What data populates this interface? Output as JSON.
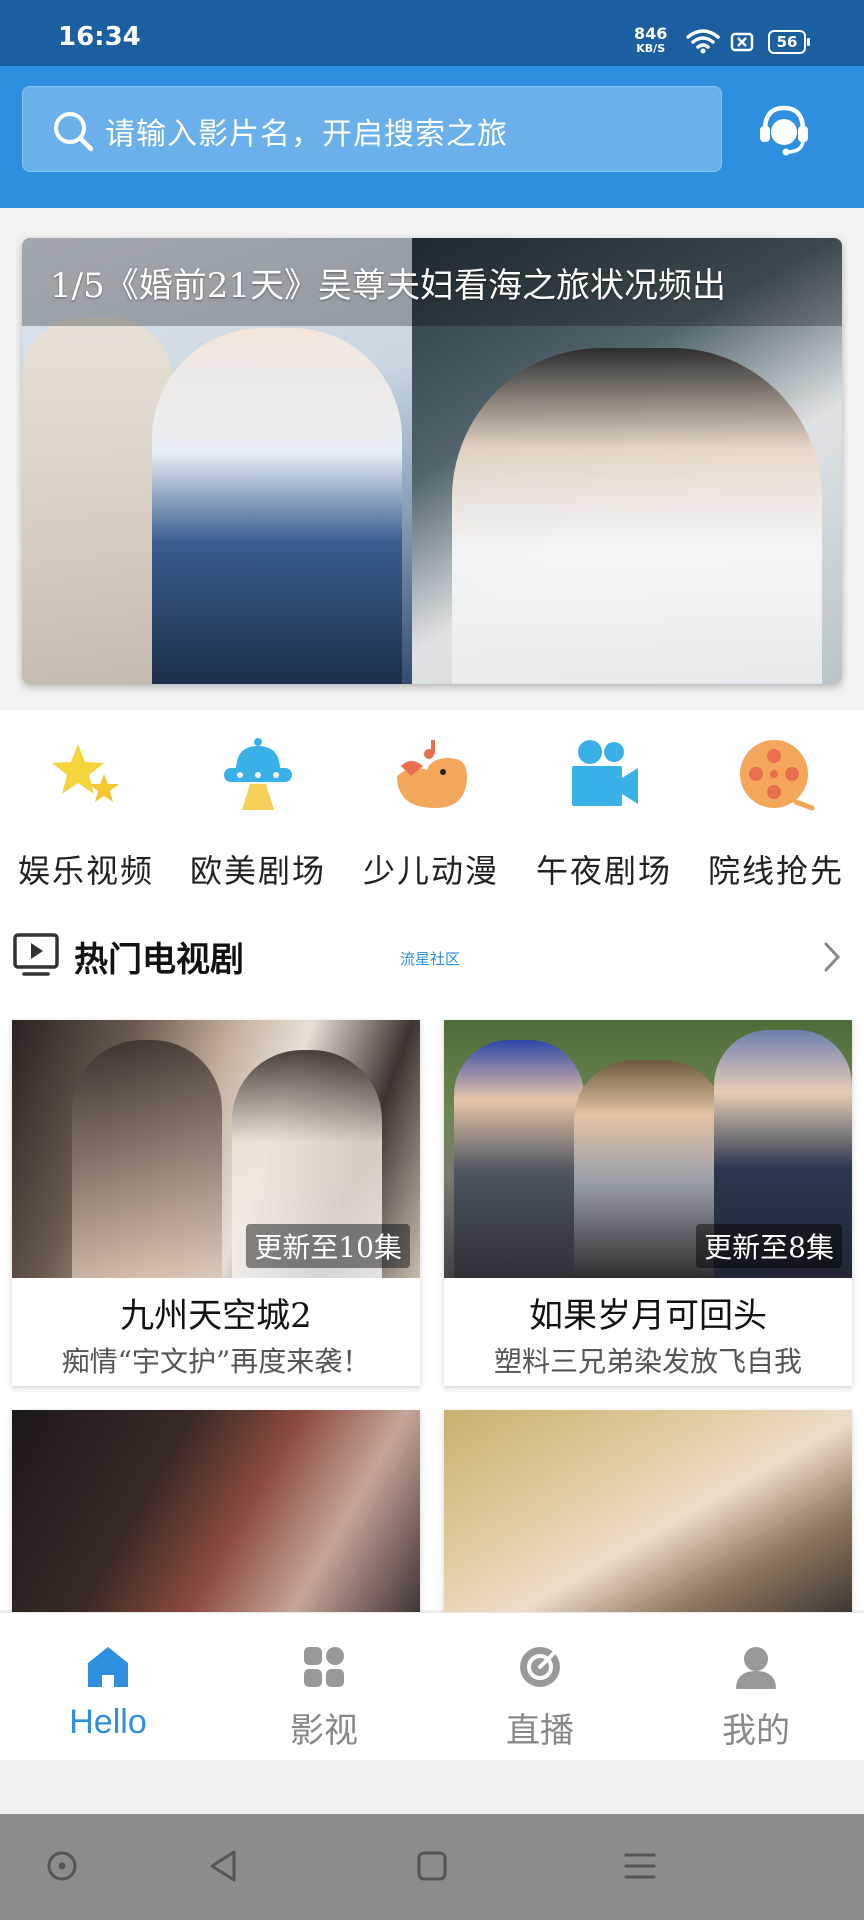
{
  "status_bar": {
    "time": "16:34",
    "net_speed": "846",
    "net_speed_unit": "KB/S",
    "battery": "56"
  },
  "search": {
    "placeholder": "请输入影片名，开启搜索之旅"
  },
  "banner": {
    "caption": "1/5《婚前21天》吴尊夫妇看海之旅状况频出"
  },
  "categories": [
    {
      "label": "娱乐视频",
      "icon": "star-icon"
    },
    {
      "label": "欧美剧场",
      "icon": "ufo-icon"
    },
    {
      "label": "少儿动漫",
      "icon": "bird-icon"
    },
    {
      "label": "午夜剧场",
      "icon": "video-camera-icon"
    },
    {
      "label": "院线抢先",
      "icon": "film-reel-icon"
    }
  ],
  "section": {
    "title": "热门电视剧",
    "subtitle": "流星社区"
  },
  "shows": [
    {
      "title": "九州天空城2",
      "desc": "痴情“宇文护”再度来袭！",
      "badge": "更新至10集"
    },
    {
      "title": "如果岁月可回头",
      "desc": "塑料三兄弟染发放飞自我",
      "badge": "更新至8集"
    }
  ],
  "tabs": [
    {
      "label": "Hello",
      "icon": "home-icon",
      "active": true
    },
    {
      "label": "影视",
      "icon": "grid-icon",
      "active": false
    },
    {
      "label": "直播",
      "icon": "live-icon",
      "active": false
    },
    {
      "label": "我的",
      "icon": "profile-icon",
      "active": false
    }
  ],
  "colors": {
    "status_bar": "#1b5fa0",
    "header": "#2e8ee0",
    "accent": "#2e8ee0"
  }
}
